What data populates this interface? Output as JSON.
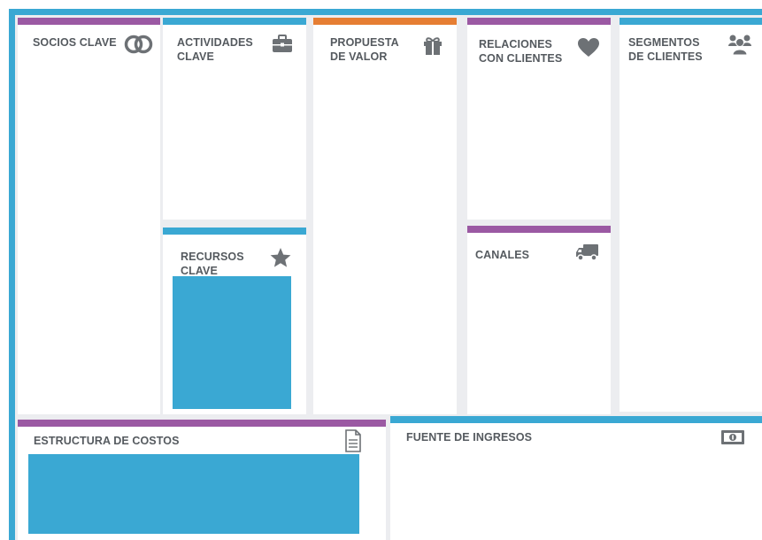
{
  "canvas": {
    "key_partners": {
      "title": "SOCIOS CLAVE",
      "icon": "rings-icon"
    },
    "key_activities": {
      "title": "ACTIVIDADES\nCLAVE",
      "icon": "briefcase-icon"
    },
    "key_resources": {
      "title": "RECURSOS\nCLAVE",
      "icon": "star-icon"
    },
    "value_proposition": {
      "title": "PROPUESTA\nDE VALOR",
      "icon": "gift-icon"
    },
    "customer_relationships": {
      "title": "RELACIONES\nCON CLIENTES",
      "icon": "heart-icon"
    },
    "channels": {
      "title": "CANALES",
      "icon": "truck-icon"
    },
    "customer_segments": {
      "title": "SEGMENTOS\nDE CLIENTES",
      "icon": "users-icon"
    },
    "cost_structure": {
      "title": "ESTRUCTURA DE COSTOS",
      "icon": "document-icon"
    },
    "revenue_streams": {
      "title": "FUENTE DE INGRESOS",
      "icon": "money-icon"
    }
  },
  "colors": {
    "frame": "#3aa8d3",
    "purple": "#9b59a3",
    "blue": "#3aa8d3",
    "orange": "#e67e33",
    "icon": "#6d7175",
    "text": "#555a5f"
  }
}
